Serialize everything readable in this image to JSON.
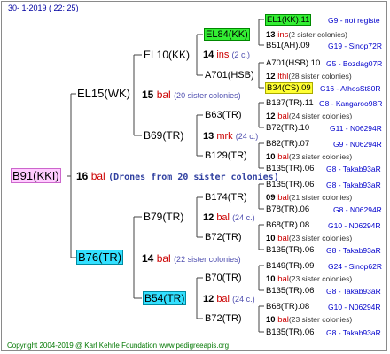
{
  "date": "30-   1-2019  ( 22:  25)",
  "copyright": "Copyright 2004-2019 @ Karl Kehrle Foundation    www.pedigreeapis.org",
  "root": {
    "name": "B91(KKI)",
    "num": "16",
    "unit": "bal",
    "note": "(Drones from 20 sister colonies)"
  },
  "gen1": [
    {
      "name": "EL15(WK)",
      "num": "15",
      "unit": "bal",
      "note": "(20 sister colonies)"
    },
    {
      "name": "B76(TR)",
      "num": "14",
      "unit": "bal",
      "note": "(22 sister colonies)"
    }
  ],
  "gen2": [
    {
      "name": "EL10(KK)",
      "num": "14",
      "unit": "ins",
      "note": "(2 c.)"
    },
    {
      "name": "B69(TR)",
      "num": "13",
      "unit": "mrk",
      "note": "(24 c.)"
    },
    {
      "name": "B79(TR)",
      "num": "12",
      "unit": "bal",
      "note": "(24 c.)"
    },
    {
      "name": "B54(TR)",
      "num": "12",
      "unit": "bal",
      "note": "(24 c.)"
    }
  ],
  "gen3": [
    {
      "name": "EL84(KK)",
      "num": "13",
      "unit": "ins",
      "note": "(2 sister colonies)"
    },
    {
      "name": "A701(HSB)",
      "num": "12",
      "unit": "lthl",
      "note": "(28 sister colonies)"
    },
    {
      "name": "B63(TR)",
      "num": "12",
      "unit": "bal",
      "note": "(24 sister colonies)"
    },
    {
      "name": "B129(TR)",
      "num": "10",
      "unit": "bal",
      "note": "(23 sister colonies)"
    },
    {
      "name": "B174(TR)",
      "num": "09",
      "unit": "bal",
      "note": "(21 sister colonies)"
    },
    {
      "name": "B72(TR)",
      "num": "10",
      "unit": "bal",
      "note": "(23 sister colonies)"
    },
    {
      "name": "B70(TR)",
      "num": "10",
      "unit": "bal",
      "note": "(23 sister colonies)"
    },
    {
      "name": "B72(TR)",
      "num": "10",
      "unit": "bal",
      "note": "(23 sister colonies)"
    }
  ],
  "gen4": [
    {
      "name": "EL1(KK).11",
      "code": "G9 - not registe"
    },
    {
      "name": "B51(AH).09",
      "code": "G19 - Sinop72R"
    },
    {
      "name": "A701(HSB).10",
      "code": "G5 - Bozdag07R"
    },
    {
      "name": "B34(CS).09",
      "code": "G16 - AthosSt80R"
    },
    {
      "name": "B137(TR).11",
      "code": "G8 - Kangaroo98R"
    },
    {
      "name": "B72(TR).10",
      "code": "G11 - N06294R"
    },
    {
      "name": "B82(TR).07",
      "code": "G9 - N06294R"
    },
    {
      "name": "B135(TR).06",
      "code": "G8 - Takab93aR"
    },
    {
      "name": "B135(TR).06",
      "code": "G8 - Takab93aR"
    },
    {
      "name": "B78(TR).06",
      "code": "G8 - N06294R"
    },
    {
      "name": "B68(TR).08",
      "code": "G10 - N06294R"
    },
    {
      "name": "B135(TR).06",
      "code": "G8 - Takab93aR"
    },
    {
      "name": "B149(TR).09",
      "code": "G24 - Sinop62R"
    },
    {
      "name": "B135(TR).06",
      "code": "G8 - Takab93aR"
    },
    {
      "name": "B68(TR).08",
      "code": "G10 - N06294R"
    },
    {
      "name": "B135(TR).06",
      "code": "G8 - Takab93aR"
    }
  ]
}
